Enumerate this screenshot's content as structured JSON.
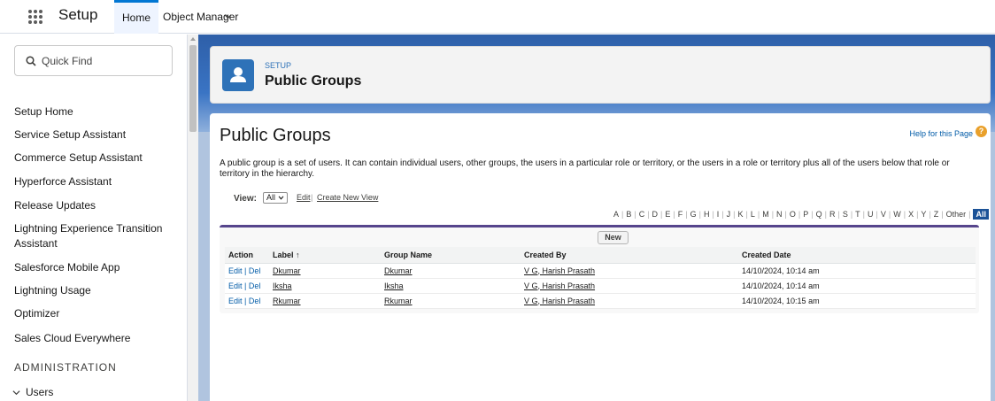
{
  "topbar": {
    "app_name": "Setup",
    "tabs": [
      {
        "label": "Home"
      },
      {
        "label": "Object Manager"
      }
    ]
  },
  "sidebar": {
    "search_placeholder": "Quick Find",
    "items": [
      {
        "label": "Setup Home"
      },
      {
        "label": "Service Setup Assistant"
      },
      {
        "label": "Commerce Setup Assistant"
      },
      {
        "label": "Hyperforce Assistant"
      },
      {
        "label": "Release Updates"
      },
      {
        "label": "Lightning Experience Transition"
      },
      {
        "label": "Assistant"
      },
      {
        "label": "Salesforce Mobile App"
      },
      {
        "label": "Lightning Usage"
      },
      {
        "label": "Optimizer"
      },
      {
        "label": "Sales Cloud Everywhere"
      }
    ],
    "section_heading": "ADMINISTRATION",
    "users_label": "Users"
  },
  "header": {
    "eyebrow": "SETUP",
    "title": "Public Groups",
    "icon": "user-icon"
  },
  "content": {
    "title": "Public Groups",
    "help_link": "Help for this Page",
    "description": "A public group is a set of users. It can contain individual users, other groups, the users in a particular role or territory, or the users in a role or territory plus all of the users below that role or territory in the hierarchy.",
    "view_label": "View:",
    "view_selected": "All",
    "view_edit": "Edit",
    "view_sep": "|",
    "view_create": "Create New View",
    "alphabet": [
      "A",
      "B",
      "C",
      "D",
      "E",
      "F",
      "G",
      "H",
      "I",
      "J",
      "K",
      "L",
      "M",
      "N",
      "O",
      "P",
      "Q",
      "R",
      "S",
      "T",
      "U",
      "V",
      "W",
      "X",
      "Y",
      "Z",
      "Other",
      "All"
    ],
    "alphabet_selected": "All",
    "new_button": "New",
    "columns": [
      "Action",
      "Label ↑",
      "Group Name",
      "Created By",
      "Created Date"
    ],
    "rows": [
      {
        "edit": "Edit",
        "sep": "|",
        "del": "Del",
        "label": "Dkumar",
        "group_name": "Dkumar",
        "created_by": "V G, Harish Prasath",
        "created_date": "14/10/2024, 10:14 am"
      },
      {
        "edit": "Edit",
        "sep": "|",
        "del": "Del",
        "label": "Iksha",
        "group_name": "Iksha",
        "created_by": "V G, Harish Prasath",
        "created_date": "14/10/2024, 10:14 am"
      },
      {
        "edit": "Edit",
        "sep": "|",
        "del": "Del",
        "label": "Rkumar",
        "group_name": "Rkumar",
        "created_by": "V G, Harish Prasath",
        "created_date": "14/10/2024, 10:15 am"
      }
    ]
  },
  "colors": {
    "brand_blue": "#0176d3",
    "header_icon": "#2e72b8",
    "link_blue": "#015ba7",
    "list_accent": "#56458c",
    "alpha_selected": "#1b5297",
    "help_icon": "#e9a02b"
  }
}
